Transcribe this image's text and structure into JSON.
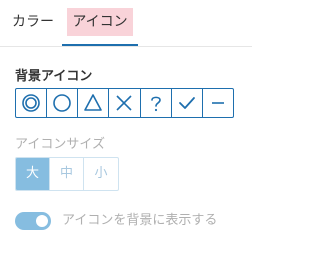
{
  "tabs": [
    {
      "label": "カラー"
    },
    {
      "label": "アイコン",
      "active": true
    }
  ],
  "background_icon": {
    "heading": "背景アイコン",
    "icons": [
      {
        "name": "double-circle-icon"
      },
      {
        "name": "circle-icon"
      },
      {
        "name": "triangle-icon"
      },
      {
        "name": "cross-icon"
      },
      {
        "name": "question-icon"
      },
      {
        "name": "check-icon"
      },
      {
        "name": "minus-icon"
      }
    ]
  },
  "icon_size": {
    "label": "アイコンサイズ",
    "options": [
      "大",
      "中",
      "小"
    ],
    "selected": "大"
  },
  "show_icon": {
    "label": "アイコンを背景に表示する",
    "enabled": true
  },
  "colors": {
    "accent": "#1e6fae",
    "active_tab_bg": "#f9d3d9",
    "toggle_on": "#86bde0"
  }
}
